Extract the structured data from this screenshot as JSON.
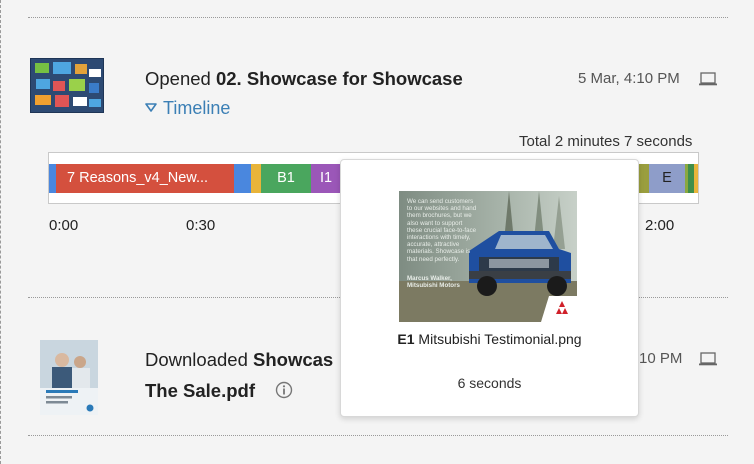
{
  "activity_opened": {
    "action": "Opened",
    "doc_title": "02. Showcase for Showcase",
    "timestamp": "5 Mar, 4:10 PM",
    "device_icon": "laptop-icon",
    "timeline_label": "Timeline",
    "total_label": "Total 2 minutes 7 seconds"
  },
  "timeline": {
    "segments": [
      {
        "label": "",
        "color": "#4a87de"
      },
      {
        "label": "7 Reasons_v4_New...",
        "color": "#d4503e"
      },
      {
        "label": "",
        "color": "#4a87de"
      },
      {
        "label": "",
        "color": "#e8b43a"
      },
      {
        "label": "B1",
        "color": "#4aa65e"
      },
      {
        "label": "I1",
        "color": "#9b57b8"
      },
      {
        "label": "",
        "color": "#9a9e3e"
      },
      {
        "label": "E",
        "color": "#8e9dc9"
      },
      {
        "label": "",
        "color": "#8aa840"
      },
      {
        "label": "",
        "color": "#3f8e4a"
      },
      {
        "label": "",
        "color": "#e8b43a"
      }
    ],
    "ticks": [
      "0:00",
      "0:30",
      "2:00"
    ]
  },
  "tooltip": {
    "slide_code": "E1",
    "file_name": "Mitsubishi Testimonial.png",
    "duration": "6 seconds",
    "preview_quote": "We can send customers to our websites and hand them brochures, but we also want to support these crucial face-to-face interactions with timely, accurate, attractive materials. Showcase is that need perfectly.",
    "preview_author": "Marcus Walker, Mitsubishi Motors"
  },
  "activity_downloaded": {
    "action": "Downloaded",
    "doc_title_line1": "Showcas",
    "doc_title_line2": "The Sale.pdf",
    "timestamp_partial": "10 PM",
    "device_icon": "laptop-icon",
    "info_icon": "info-icon"
  }
}
